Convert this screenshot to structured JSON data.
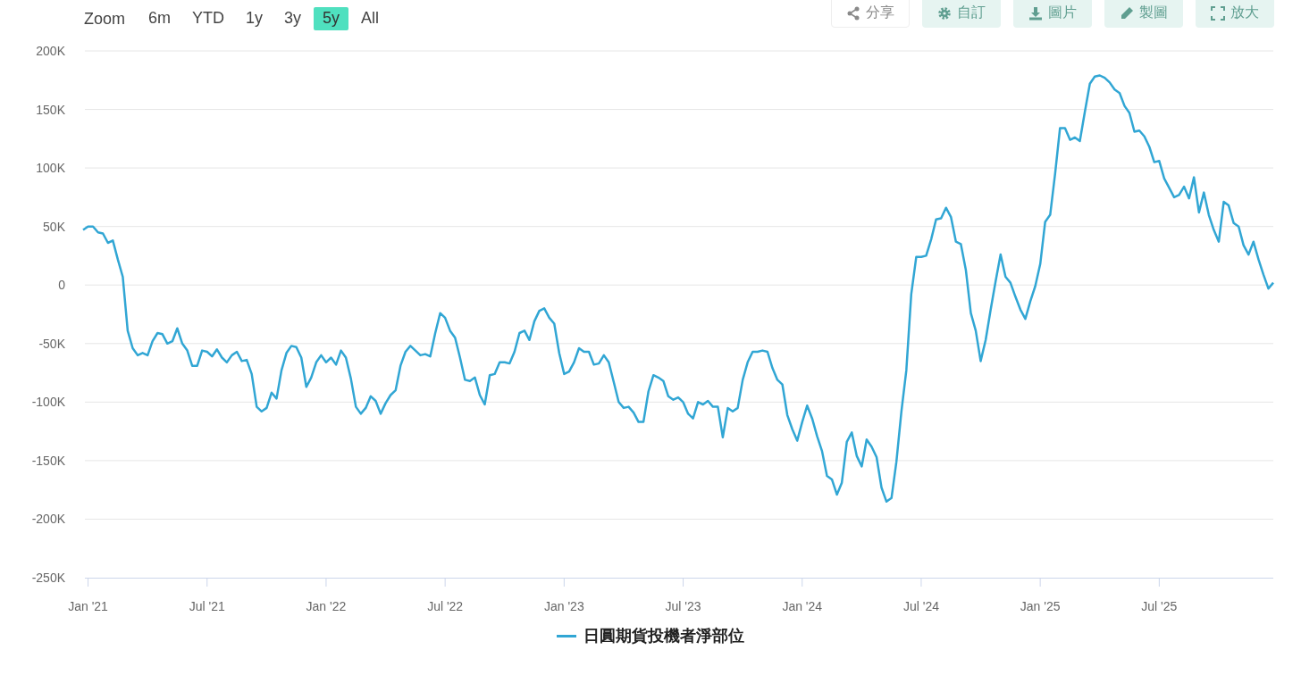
{
  "range_selector": {
    "label": "Zoom",
    "buttons": [
      {
        "label": "6m",
        "selected": false
      },
      {
        "label": "YTD",
        "selected": false
      },
      {
        "label": "1y",
        "selected": false
      },
      {
        "label": "3y",
        "selected": false
      },
      {
        "label": "5y",
        "selected": true
      },
      {
        "label": "All",
        "selected": false
      }
    ]
  },
  "toolbar": [
    {
      "kind": "share",
      "label": "分享",
      "disabled": true
    },
    {
      "kind": "customize",
      "label": "自訂",
      "disabled": true
    },
    {
      "kind": "download",
      "label": "圖片",
      "disabled": true
    },
    {
      "kind": "edit",
      "label": "製圖",
      "disabled": true
    },
    {
      "kind": "fullscreen",
      "label": "放大",
      "disabled": true
    }
  ],
  "chart": {
    "chart_data": {
      "type": "line",
      "grid": true,
      "categories": [
        null,
        "Jan '21",
        null,
        null,
        null,
        null,
        null,
        null,
        null,
        null,
        null,
        null,
        null,
        null,
        null,
        null,
        null,
        null,
        null,
        null,
        null,
        null,
        null,
        null,
        null,
        "Jul '21",
        null,
        null,
        null,
        null,
        null,
        null,
        null,
        null,
        null,
        null,
        null,
        null,
        null,
        null,
        null,
        null,
        null,
        null,
        null,
        null,
        null,
        null,
        null,
        "Jan '22",
        null,
        null,
        null,
        null,
        null,
        null,
        null,
        null,
        null,
        null,
        null,
        null,
        null,
        null,
        null,
        null,
        null,
        null,
        null,
        null,
        null,
        null,
        null,
        "Jul '22",
        null,
        null,
        null,
        null,
        null,
        null,
        null,
        null,
        null,
        null,
        null,
        null,
        null,
        null,
        null,
        null,
        null,
        null,
        null,
        null,
        null,
        null,
        null,
        "Jan '23",
        null,
        null,
        null,
        null,
        null,
        null,
        null,
        null,
        null,
        null,
        null,
        null,
        null,
        null,
        null,
        null,
        null,
        null,
        null,
        null,
        null,
        null,
        null,
        "Jul '23",
        null,
        null,
        null,
        null,
        null,
        null,
        null,
        null,
        null,
        null,
        null,
        null,
        null,
        null,
        null,
        null,
        null,
        null,
        null,
        null,
        null,
        null,
        null,
        "Jan '24",
        null,
        null,
        null,
        null,
        null,
        null,
        null,
        null,
        null,
        null,
        null,
        null,
        null,
        null,
        null,
        null,
        null,
        null,
        null,
        null,
        null,
        null,
        null,
        "Jul '24",
        null,
        null,
        null,
        null,
        null,
        null,
        null,
        null,
        null,
        null,
        null,
        null,
        null,
        null,
        null,
        null,
        null,
        null,
        null,
        null,
        null,
        null,
        null,
        "Jan '25",
        null,
        null,
        null,
        null,
        null,
        null,
        null,
        null,
        null,
        null,
        null,
        null,
        null,
        null,
        null,
        null,
        null,
        null,
        null,
        null,
        null,
        null,
        null,
        "Jul '25",
        null,
        null,
        null,
        null,
        null,
        null,
        null,
        null,
        null,
        null,
        null,
        null,
        null,
        null,
        null,
        null,
        null,
        null,
        null,
        null,
        null,
        null,
        null
      ],
      "ylim": [
        -250,
        200
      ],
      "yticks": [
        {
          "value": 200,
          "label": "200K"
        },
        {
          "value": 150,
          "label": "150K"
        },
        {
          "value": 100,
          "label": "100K"
        },
        {
          "value": 50,
          "label": "50K"
        },
        {
          "value": 0,
          "label": "0"
        },
        {
          "value": -50,
          "label": "-50K"
        },
        {
          "value": -100,
          "label": "-100K"
        },
        {
          "value": -150,
          "label": "-150K"
        },
        {
          "value": -200,
          "label": "-200K"
        },
        {
          "value": -250,
          "label": "-250K"
        }
      ],
      "series": [
        {
          "name": "日圓期貨投機者淨部位",
          "color": "#31a6d4",
          "values": [
            47,
            50,
            50,
            45,
            44,
            36,
            38,
            22,
            7,
            -39,
            -54,
            -60,
            -58,
            -60,
            -48,
            -41,
            -42,
            -50,
            -48,
            -37,
            -50,
            -56,
            -69,
            -69,
            -56,
            -57,
            -61,
            -55,
            -62,
            -66,
            -60,
            -57,
            -65,
            -64,
            -76,
            -104,
            -108,
            -105,
            -92,
            -97,
            -73,
            -58,
            -52,
            -53,
            -62,
            -87,
            -79,
            -66,
            -60,
            -66,
            -62,
            -68,
            -56,
            -62,
            -80,
            -104,
            -110,
            -105,
            -95,
            -99,
            -110,
            -101,
            -94,
            -90,
            -69,
            -57,
            -52,
            -56,
            -60,
            -59,
            -61,
            -41,
            -24,
            -28,
            -39,
            -45,
            -62,
            -81,
            -82,
            -79,
            -94,
            -102,
            -77,
            -76,
            -66,
            -66,
            -67,
            -57,
            -41,
            -39,
            -47,
            -31,
            -22,
            -20,
            -28,
            -33,
            -58,
            -76,
            -74,
            -66,
            -54,
            -57,
            -57,
            -68,
            -67,
            -60,
            -66,
            -83,
            -100,
            -105,
            -104,
            -109,
            -117,
            -117,
            -91,
            -77,
            -79,
            -82,
            -95,
            -98,
            -96,
            -100,
            -110,
            -114,
            -100,
            -102,
            -99,
            -104,
            -104,
            -130,
            -105,
            -108,
            -105,
            -81,
            -66,
            -57,
            -57,
            -56,
            -57,
            -71,
            -81,
            -85,
            -111,
            -123,
            -133,
            -117,
            -103,
            -114,
            -129,
            -142,
            -163,
            -166,
            -179,
            -169,
            -134,
            -126,
            -146,
            -155,
            -132,
            -138,
            -147,
            -173,
            -185,
            -182,
            -151,
            -108,
            -73,
            -8,
            24,
            24,
            25,
            39,
            56,
            57,
            66,
            58,
            37,
            35,
            13,
            -24,
            -39,
            -65,
            -47,
            -21,
            3,
            26,
            7,
            2,
            -10,
            -21,
            -29,
            -14,
            -1,
            18,
            54,
            60,
            95,
            134,
            134,
            124,
            126,
            123,
            148,
            172,
            178,
            179,
            177,
            173,
            167,
            164,
            153,
            147,
            131,
            132,
            127,
            118,
            105,
            106,
            91,
            83,
            75,
            77,
            84,
            74,
            92,
            62,
            79,
            60,
            47,
            37,
            71,
            68,
            53,
            50,
            34,
            26,
            37,
            22,
            9,
            -3,
            2
          ]
        }
      ]
    }
  }
}
